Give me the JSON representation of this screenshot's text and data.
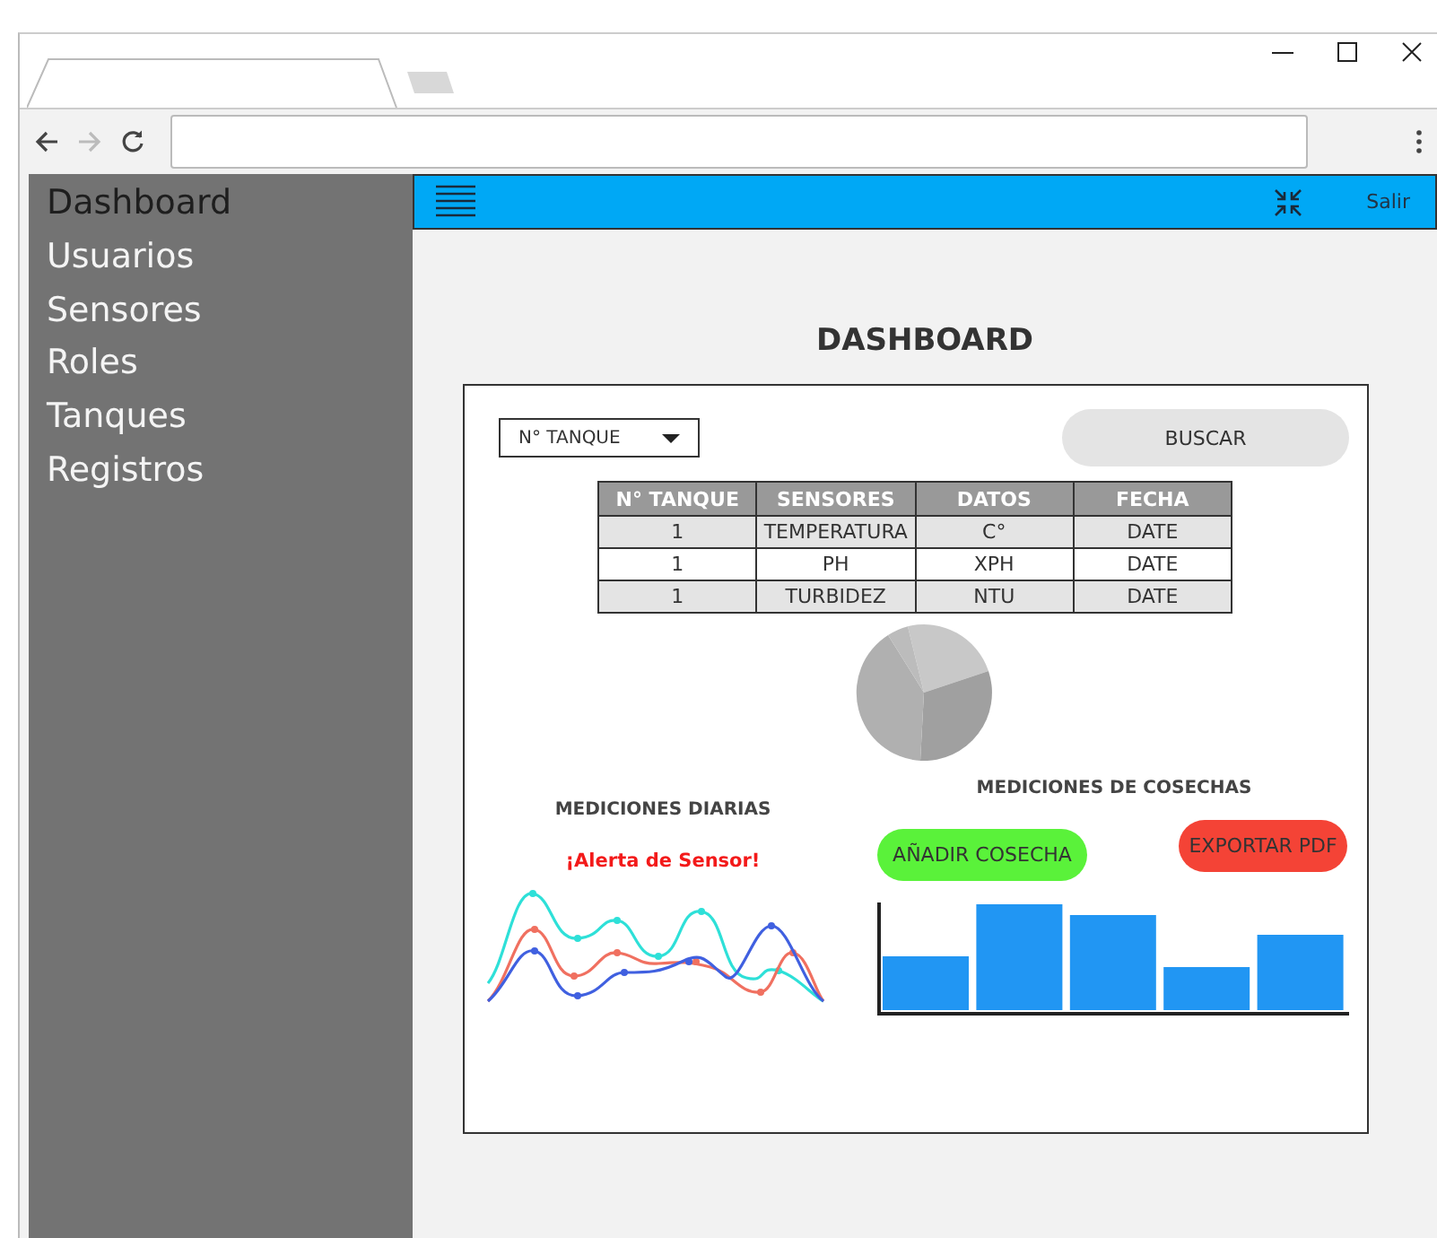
{
  "sidebar": {
    "items": [
      {
        "label": "Dashboard",
        "selected": true
      },
      {
        "label": "Usuarios",
        "selected": false
      },
      {
        "label": "Sensores",
        "selected": false
      },
      {
        "label": "Roles",
        "selected": false
      },
      {
        "label": "Tanques",
        "selected": false
      },
      {
        "label": "Registros",
        "selected": false
      }
    ]
  },
  "topbar": {
    "exit": "Salir"
  },
  "title": "DASHBOARD",
  "filter": {
    "value": "N° TANQUE"
  },
  "search_button": "BUSCAR",
  "table": {
    "columns": [
      "N° TANQUE",
      "SENSORES",
      "DATOS",
      "FECHA"
    ],
    "rows": [
      [
        "1",
        "TEMPERATURA",
        "C°",
        "DATE"
      ],
      [
        "1",
        "PH",
        "XPH",
        "DATE"
      ],
      [
        "1",
        "TURBIDEZ",
        "NTU",
        "DATE"
      ]
    ]
  },
  "daily": {
    "title": "MEDICIONES DIARIAS",
    "alert": "¡Alerta de Sensor!"
  },
  "harvest": {
    "title": "MEDICIONES DE COSECHAS",
    "add_button": "AÑADIR COSECHA",
    "export_button": "EXPORTAR PDF"
  }
}
